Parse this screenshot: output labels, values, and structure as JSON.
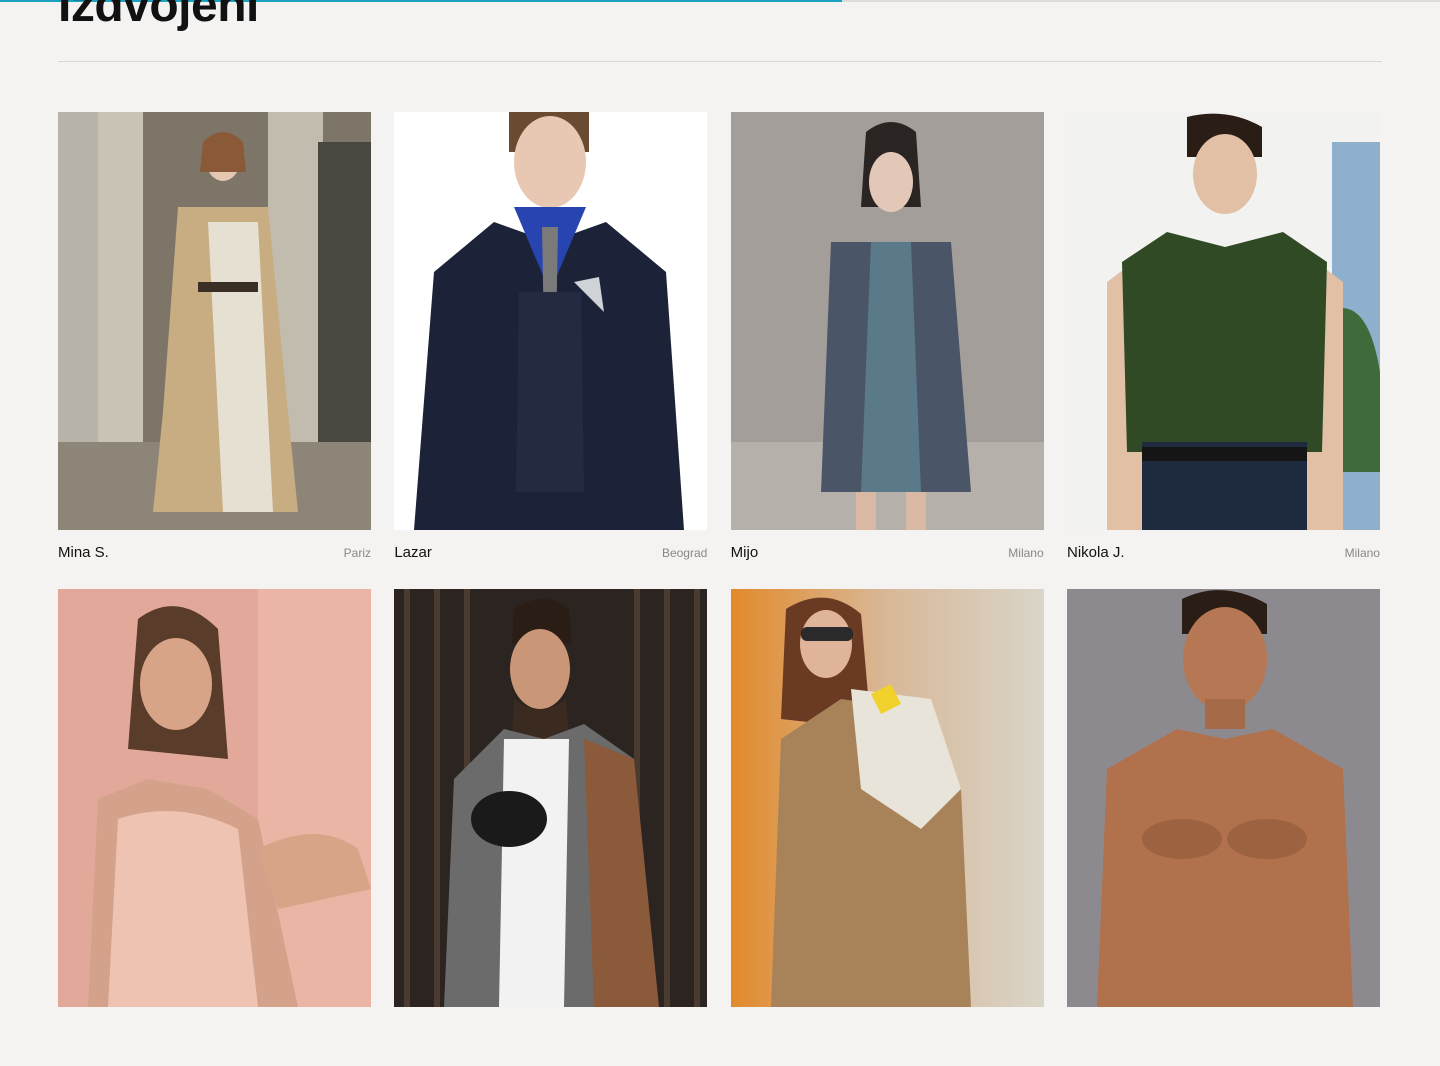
{
  "page": {
    "scroll_progress_percent": 58.5,
    "section_title": "Izdvojeni"
  },
  "colors": {
    "progress": "#1aa3c1",
    "background": "#f4f3f1"
  },
  "models": [
    {
      "name": "Mina S.",
      "city": "Pariz"
    },
    {
      "name": "Lazar",
      "city": "Beograd"
    },
    {
      "name": "Mijo",
      "city": "Milano"
    },
    {
      "name": "Nikola J.",
      "city": "Milano"
    },
    {
      "name": "",
      "city": ""
    },
    {
      "name": "",
      "city": ""
    },
    {
      "name": "",
      "city": ""
    },
    {
      "name": "",
      "city": ""
    }
  ]
}
